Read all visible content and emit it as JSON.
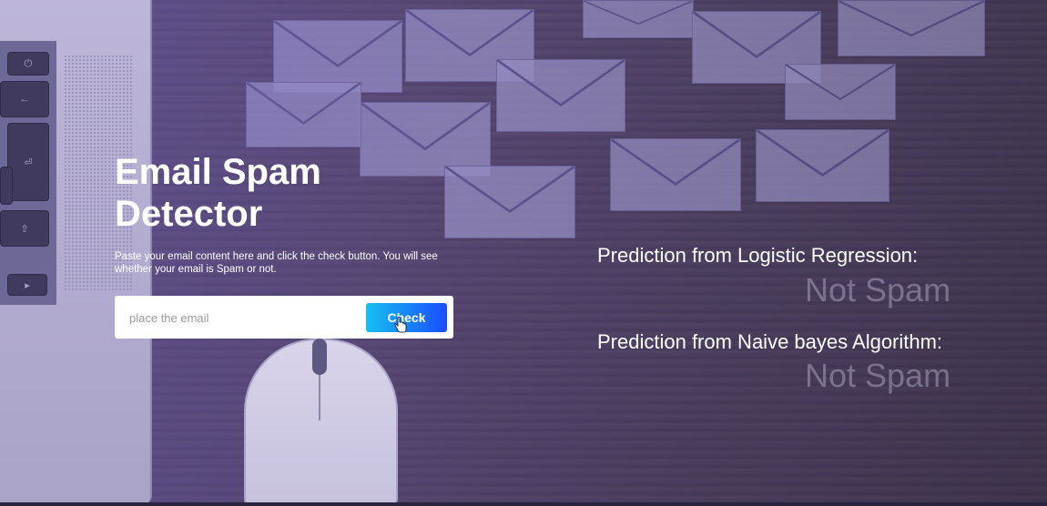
{
  "hero": {
    "title": "Email Spam Detector",
    "description": "Paste your email content here and click the check button. You will see whether your email is Spam or not."
  },
  "form": {
    "email_placeholder": "place the email",
    "email_value": "",
    "check_label": "Check"
  },
  "predictions": [
    {
      "label": "Prediction from Logistic Regression:",
      "result": "Not Spam"
    },
    {
      "label": "Prediction from Naive bayes Algorithm:",
      "result": "Not Spam"
    }
  ],
  "background": {
    "keyboard_keys": [
      "⏻",
      "←",
      "⏎",
      "⇧",
      "▸"
    ]
  },
  "colors": {
    "button_gradient_start": "#16c0f0",
    "button_gradient_end": "#1a4cff",
    "overlay": "#5a4a8c"
  }
}
